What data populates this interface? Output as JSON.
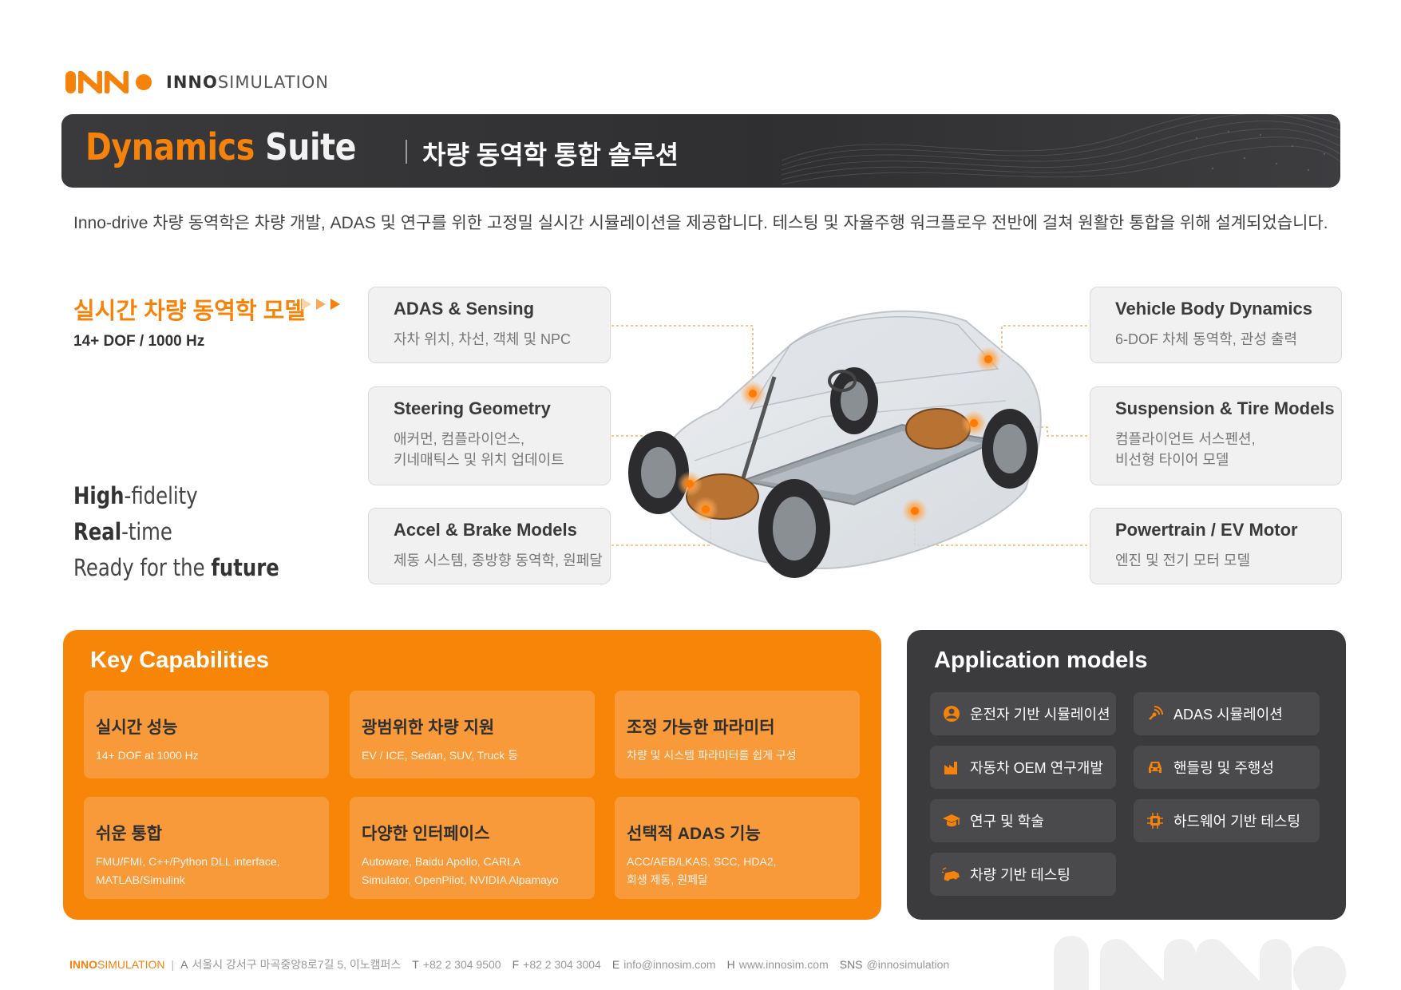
{
  "header": {
    "brand_bold": "INNO",
    "brand_light": "SIMULATION"
  },
  "title": {
    "main_word1": "Dynamics",
    "main_word2": "Suite",
    "subtitle": "차량 동역학 통합 솔루션"
  },
  "intro": "Inno-drive 차량 동역학은 차량 개발, ADAS 및 연구를 위한 고정밀 실시간 시뮬레이션을 제공합니다. 테스팅 및 자율주행 워크플로우 전반에 걸쳐 원활한 통합을 위해 설계되었습니다.",
  "realtime": {
    "title": "실시간 차량 동역학 모델",
    "spec": "14+ DOF  /  1000 Hz"
  },
  "tagline": [
    {
      "bold": "High",
      "rest": "-fidelity"
    },
    {
      "bold": "Real",
      "rest": "-time"
    },
    {
      "pre": "Ready for the ",
      "bold": "future"
    }
  ],
  "features_left": [
    {
      "title": "ADAS & Sensing",
      "desc": "자차 위치, 차선, 객체 및 NPC"
    },
    {
      "title": "Steering Geometry",
      "desc": "애커먼, 컴플라이언스,\n키네매틱스 및 위치 업데이트"
    },
    {
      "title": "Accel & Brake Models",
      "desc": "제동 시스템, 종방향 동역학, 원페달"
    }
  ],
  "features_right": [
    {
      "title": "Vehicle Body Dynamics",
      "desc": "6-DOF 차체 동역학, 관성 출력"
    },
    {
      "title": "Suspension & Tire Models",
      "desc": "컴플라이언트 서스펜션,\n비선형 타이어 모델"
    },
    {
      "title": "Powertrain / EV Motor",
      "desc": "엔진 및 전기 모터 모델"
    }
  ],
  "capabilities": {
    "title": "Key Capabilities",
    "items": [
      {
        "title": "실시간 성능",
        "desc": "14+ DOF at 1000 Hz"
      },
      {
        "title": "광범위한 차량 지원",
        "desc": "EV / ICE, Sedan, SUV, Truck 등"
      },
      {
        "title": "조정 가능한 파라미터",
        "desc": "차량 및 시스템 파라미터를 쉽게 구성"
      },
      {
        "title": "쉬운 통합",
        "desc": "FMU/FMI, C++/Python DLL interface,\nMATLAB/Simulink"
      },
      {
        "title": "다양한 인터페이스",
        "desc": "Autoware, Baidu Apollo, CARLA\nSimulator, OpenPilot, NVIDIA Alpamayo"
      },
      {
        "title": "선택적 ADAS 기능",
        "desc": "ACC/AEB/LKAS, SCC, HDA2,\n회생 제동, 원페달"
      }
    ]
  },
  "applications": {
    "title": "Application models",
    "items": [
      {
        "label": "운전자 기반 시뮬레이션",
        "icon": "driver-icon"
      },
      {
        "label": "ADAS 시뮬레이션",
        "icon": "radar-icon"
      },
      {
        "label": "자동차 OEM 연구개발",
        "icon": "factory-icon"
      },
      {
        "label": "핸들링 및 주행성",
        "icon": "car-front-icon"
      },
      {
        "label": "연구 및 학술",
        "icon": "graduation-cap-icon"
      },
      {
        "label": "하드웨어 기반 테스팅",
        "icon": "chip-icon"
      },
      {
        "label": "차량 기반 테스팅",
        "icon": "car-test-icon"
      }
    ]
  },
  "footer": {
    "brand_bold": "INNO",
    "brand_light": "SIMULATION",
    "address_label": "A",
    "address": "서울시 강서구 마곡중앙8로7길 5, 이노캠퍼스",
    "tel_label": "T",
    "tel": "+82 2 304 9500",
    "fax_label": "F",
    "fax": "+82 2 304 3004",
    "email_label": "E",
    "email": "info@innosim.com",
    "web_label": "H",
    "web": "www.innosim.com",
    "sns_label": "SNS",
    "sns": "@innosimulation"
  },
  "colors": {
    "accent": "#f5820a",
    "dark": "#3b3b3d",
    "card": "#f1f1f2"
  }
}
